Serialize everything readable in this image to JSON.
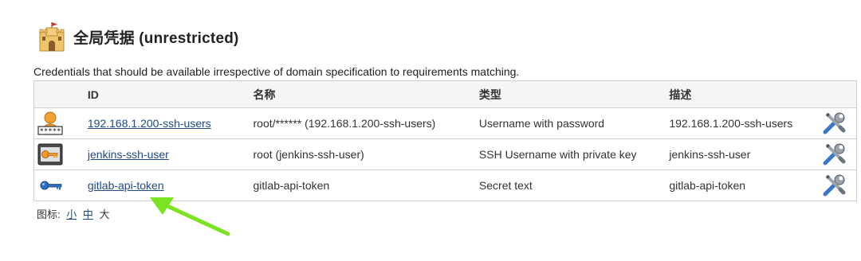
{
  "page": {
    "heading": "全局凭据 (unrestricted)",
    "description": "Credentials that should be available irrespective of domain specification to requirements matching."
  },
  "table": {
    "columns": [
      "ID",
      "名称",
      "类型",
      "描述"
    ],
    "rows": [
      {
        "icon": "user-password-icon",
        "id": "192.168.1.200-ssh-users",
        "name": "root/****** (192.168.1.200-ssh-users)",
        "type": "Username with password",
        "description": "192.168.1.200-ssh-users"
      },
      {
        "icon": "ssh-key-icon",
        "id": "jenkins-ssh-user",
        "name": "root (jenkins-ssh-user)",
        "type": "SSH Username with private key",
        "description": "jenkins-ssh-user"
      },
      {
        "icon": "secret-key-icon",
        "id": "gitlab-api-token",
        "name": "gitlab-api-token",
        "type": "Secret text",
        "description": "gitlab-api-token"
      }
    ]
  },
  "icon_size": {
    "label": "图标:",
    "small": "小",
    "medium": "中",
    "large": "大"
  },
  "colors": {
    "link": "#204a87",
    "annotation_arrow": "#7be321"
  }
}
